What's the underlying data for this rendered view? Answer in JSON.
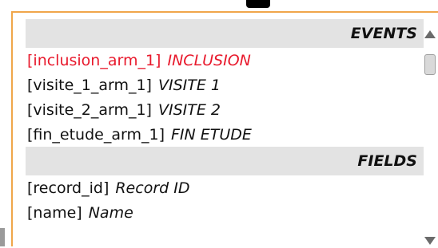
{
  "events_header": "EVENTS",
  "events": [
    {
      "id": "[inclusion_arm_1]",
      "label": "INCLUSION",
      "active": true
    },
    {
      "id": "[visite_1_arm_1]",
      "label": "VISITE 1",
      "active": false
    },
    {
      "id": "[visite_2_arm_1]",
      "label": "VISITE 2",
      "active": false
    },
    {
      "id": "[fin_etude_arm_1]",
      "label": "FIN ETUDE",
      "active": false
    }
  ],
  "fields_header": "FIELDS",
  "fields": [
    {
      "id": "[record_id]",
      "label": "Record ID"
    },
    {
      "id": "[name]",
      "label": "Name"
    }
  ],
  "colors": {
    "panel_border": "#f0a64a",
    "header_bg": "#e3e3e3",
    "active_item": "#e8192c",
    "text": "#111111"
  },
  "icons": {
    "scroll_up": "chevron-up-icon",
    "scroll_down": "chevron-down-icon"
  }
}
